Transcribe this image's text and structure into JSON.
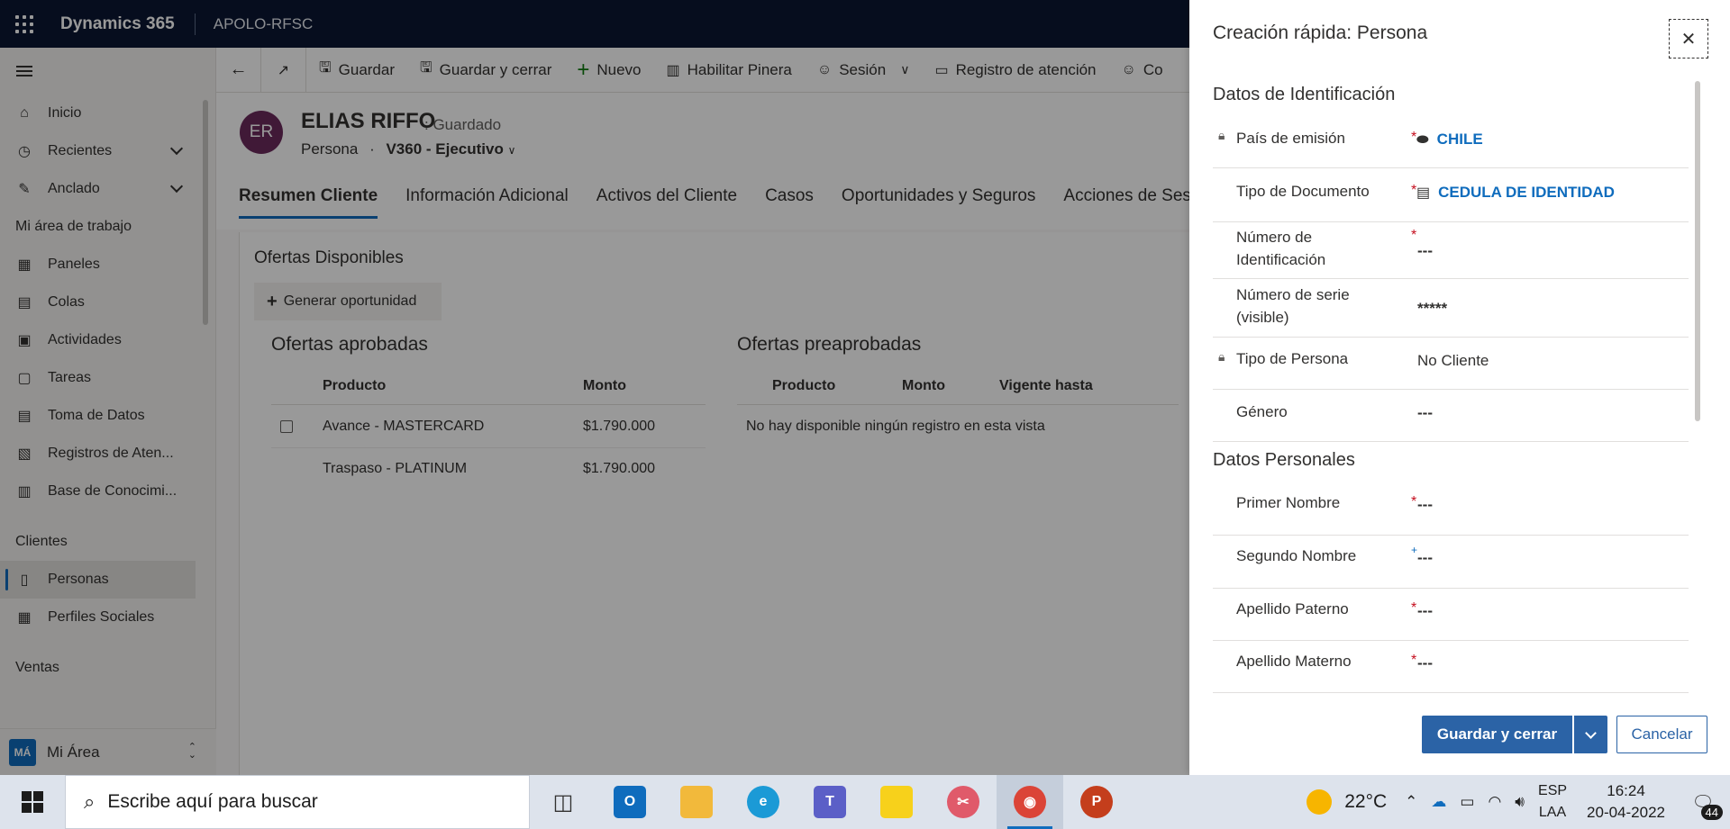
{
  "topbar": {
    "app_name": "Dynamics 365",
    "environment": "APOLO-RFSC"
  },
  "sitemap": {
    "items": [
      {
        "label": "Inicio",
        "icon": "home-icon",
        "glyph": "⌂",
        "chevron": false
      },
      {
        "label": "Recientes",
        "icon": "clock-icon",
        "glyph": "◷",
        "chevron": true
      },
      {
        "label": "Anclado",
        "icon": "pin-icon",
        "glyph": "✎",
        "chevron": true
      }
    ],
    "workspace_title": "Mi área de trabajo",
    "workspace_items": [
      {
        "label": "Paneles",
        "icon": "dashboard-icon",
        "glyph": "▦"
      },
      {
        "label": "Colas",
        "icon": "queue-icon",
        "glyph": "▤"
      },
      {
        "label": "Actividades",
        "icon": "activities-icon",
        "glyph": "▣"
      },
      {
        "label": "Tareas",
        "icon": "tasks-icon",
        "glyph": "▢"
      },
      {
        "label": "Toma de Datos",
        "icon": "data-icon",
        "glyph": "▤"
      },
      {
        "label": "Registros de Aten...",
        "icon": "records-icon",
        "glyph": "▧"
      },
      {
        "label": "Base de Conocimi...",
        "icon": "knowledge-icon",
        "glyph": "▥"
      }
    ],
    "clients_title": "Clientes",
    "client_items": [
      {
        "label": "Personas",
        "icon": "person-icon",
        "glyph": "▯",
        "active": true
      },
      {
        "label": "Perfiles Sociales",
        "icon": "social-icon",
        "glyph": "▦",
        "active": false
      }
    ],
    "sales_title": "Ventas",
    "area": {
      "badge": "MÁ",
      "label": "Mi Área"
    }
  },
  "commandbar": {
    "buttons": [
      {
        "label": "Guardar",
        "icon": "save-icon",
        "glyph": "▪"
      },
      {
        "label": "Guardar y cerrar",
        "icon": "save-close-icon",
        "glyph": "▪"
      },
      {
        "label": "Nuevo",
        "icon": "plus-icon",
        "glyph": "+"
      },
      {
        "label": "Habilitar Pinera",
        "icon": "building-icon",
        "glyph": "▥"
      },
      {
        "label": "Sesión",
        "icon": "session-icon",
        "glyph": "☺"
      },
      {
        "label": "Registro de atención",
        "icon": "register-icon",
        "glyph": "▭"
      },
      {
        "label": "Co",
        "icon": "contacts-icon",
        "glyph": "☺"
      }
    ]
  },
  "record": {
    "initials": "ER",
    "name": "ELIAS RIFFO",
    "save_status": ": Guardado",
    "entity": "Persona",
    "separator": "·",
    "form": "V360 - Ejecutivo",
    "tabs": [
      "Resumen Cliente",
      "Información Adicional",
      "Activos del Cliente",
      "Casos",
      "Oportunidades y Seguros",
      "Acciones de Sesión"
    ],
    "section_title": "Ofertas Disponibles",
    "generate_button": "Generar oportunidad",
    "approved": {
      "title": "Ofertas aprobadas",
      "columns": [
        "Producto",
        "Monto"
      ],
      "rows": [
        {
          "product": "Avance - MASTERCARD",
          "amount": "$1.790.000"
        },
        {
          "product": "Traspaso - PLATINUM",
          "amount": "$1.790.000"
        }
      ]
    },
    "preapproved": {
      "title": "Ofertas preaprobadas",
      "columns": [
        "Producto",
        "Monto",
        "Vigente hasta"
      ],
      "empty": "No hay disponible ningún registro en esta vista"
    }
  },
  "quick_create": {
    "title": "Creación rápida: Persona",
    "section1": "Datos de Identificación",
    "fields1": [
      {
        "label": "País de emisión",
        "value": "CHILE",
        "required": true,
        "locked": true,
        "lookup_icon": "tag-icon"
      },
      {
        "label": "Tipo de Documento",
        "value": "CEDULA DE IDENTIDAD",
        "required": true,
        "locked": false,
        "lookup_icon": "card-icon"
      },
      {
        "label": "Número de Identificación",
        "value": "---",
        "required": true,
        "locked": false
      },
      {
        "label": "Número de serie (visible)",
        "value": "*****",
        "required": false,
        "locked": false
      },
      {
        "label": "Tipo de Persona",
        "value": "No Cliente",
        "required": false,
        "locked": true
      },
      {
        "label": "Género",
        "value": "---",
        "required": false,
        "locked": false
      }
    ],
    "section2": "Datos Personales",
    "fields2": [
      {
        "label": "Primer Nombre",
        "value": "---",
        "required": true
      },
      {
        "label": "Segundo Nombre",
        "value": "---",
        "recommended": true
      },
      {
        "label": "Apellido Paterno",
        "value": "---",
        "required": true
      },
      {
        "label": "Apellido Materno",
        "value": "---",
        "required": true
      }
    ],
    "required_mark": "*",
    "recommended_mark": "+",
    "save_close": "Guardar y cerrar",
    "cancel": "Cancelar"
  },
  "taskbar": {
    "search_placeholder": "Escribe aquí para buscar",
    "apps": [
      {
        "name": "task-view",
        "glyph": "▯",
        "color": ""
      },
      {
        "name": "outlook",
        "glyph": "O",
        "color": "#0f6cbd"
      },
      {
        "name": "file-explorer",
        "glyph": "▬",
        "color": "#f2b93b"
      },
      {
        "name": "edge",
        "glyph": "e",
        "color": "#1b9ad6"
      },
      {
        "name": "teams",
        "glyph": "T",
        "color": "#5b5fc7"
      },
      {
        "name": "sticky-notes",
        "glyph": "▰",
        "color": "#f7d11b"
      },
      {
        "name": "snipping-tool",
        "glyph": "✂",
        "color": "#e05a6a"
      },
      {
        "name": "chrome",
        "glyph": "◉",
        "color": "#db4437"
      },
      {
        "name": "powerpoint",
        "glyph": "P",
        "color": "#c43e1c"
      }
    ],
    "active_app": "chrome",
    "temperature": "22°C",
    "language": "ESP",
    "layout": "LAA",
    "time": "16:24",
    "date": "20-04-2022",
    "notifications": "44"
  }
}
